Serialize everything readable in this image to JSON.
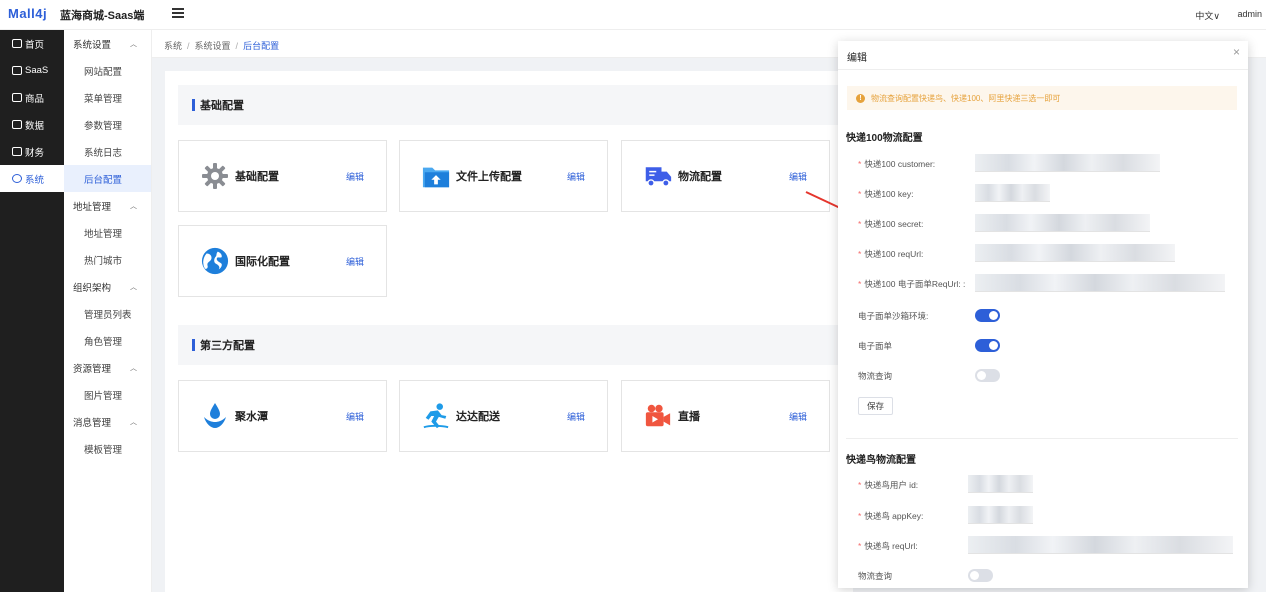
{
  "header": {
    "logo": "Mall4j",
    "app_name": "蓝海商城-Saas端",
    "lang": "中文∨",
    "user": "admin"
  },
  "rail": [
    {
      "label": "首页",
      "active": false
    },
    {
      "label": "SaaS",
      "active": false
    },
    {
      "label": "商品",
      "active": false
    },
    {
      "label": "数据",
      "active": false
    },
    {
      "label": "财务",
      "active": false
    },
    {
      "label": "系统",
      "active": true
    }
  ],
  "sidebar": {
    "groups": [
      {
        "label": "系统设置",
        "items": [
          "网站配置",
          "菜单管理",
          "参数管理",
          "系统日志",
          "后台配置"
        ]
      },
      {
        "label": "地址管理",
        "items": [
          "地址管理",
          "热门城市"
        ]
      },
      {
        "label": "组织架构",
        "items": [
          "管理员列表",
          "角色管理"
        ]
      },
      {
        "label": "资源管理",
        "items": [
          "图片管理"
        ]
      },
      {
        "label": "消息管理",
        "items": [
          "模板管理"
        ]
      }
    ],
    "active_item": "后台配置"
  },
  "breadcrumb": {
    "items": [
      "系统",
      "系统设置"
    ],
    "current": "后台配置"
  },
  "sections": [
    {
      "title": "基础配置",
      "cards": [
        {
          "title": "基础配置",
          "icon": "gear-icon",
          "edit": "编辑"
        },
        {
          "title": "文件上传配置",
          "icon": "upload-folder-icon",
          "edit": "编辑"
        },
        {
          "title": "物流配置",
          "icon": "truck-icon",
          "edit": "编辑"
        },
        {
          "title": "国际化配置",
          "icon": "globe-icon",
          "edit": "编辑"
        }
      ]
    },
    {
      "title": "第三方配置",
      "cards": [
        {
          "title": "聚水潭",
          "icon": "water-drop-icon",
          "edit": "编辑"
        },
        {
          "title": "达达配送",
          "icon": "runner-icon",
          "edit": "编辑"
        },
        {
          "title": "直播",
          "icon": "video-camera-icon",
          "edit": "编辑"
        }
      ]
    }
  ],
  "dialog": {
    "title": "编辑",
    "alert": "物流查询配置快递鸟、快递100、阿里快递三选一即可",
    "kuaidi100": {
      "title": "快递100物流配置",
      "fields": [
        "快递100 customer:",
        "快递100 key:",
        "快递100 secret:",
        "快递100 reqUrl:",
        "快递100 电子面单ReqUrl: :"
      ],
      "toggles": [
        {
          "label": "电子面单沙箱环境:",
          "on": true
        },
        {
          "label": "电子面单",
          "on": true
        },
        {
          "label": "物流查询",
          "on": false
        }
      ],
      "save": "保存"
    },
    "kdniao": {
      "title": "快递鸟物流配置",
      "fields": [
        "快递鸟用户 id:",
        "快递鸟 appKey:",
        "快递鸟 reqUrl:"
      ],
      "toggles": [
        {
          "label": "物流查询",
          "on": false
        }
      ]
    }
  },
  "colors": {
    "primary": "#2d5fd8",
    "rail_bg": "#1f1f1f",
    "warning": "#e6a23c",
    "required": "#f56c6c"
  }
}
